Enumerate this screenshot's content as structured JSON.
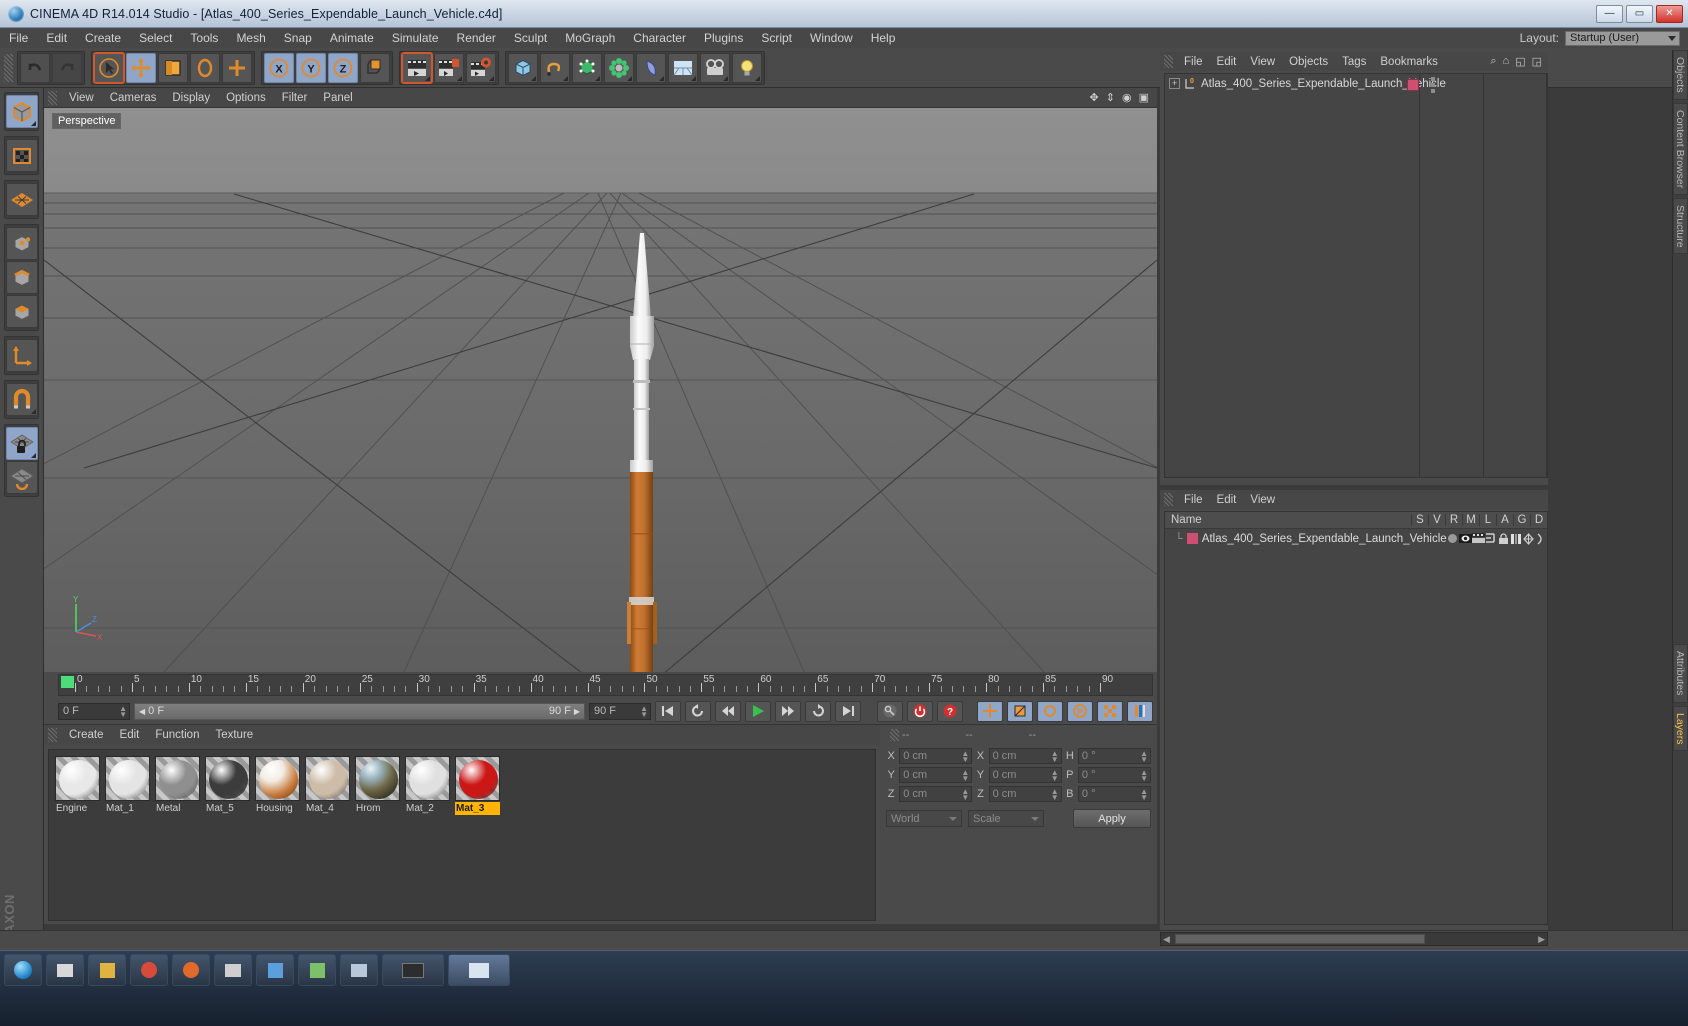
{
  "window": {
    "title": "CINEMA 4D R14.014 Studio - [Atlas_400_Series_Expendable_Launch_Vehicle.c4d]",
    "app_icon": "cinema4d-logo-icon",
    "minimize_label": "—",
    "maximize_label": "▭",
    "close_label": "✕"
  },
  "menubar": {
    "items": [
      {
        "label": "File"
      },
      {
        "label": "Edit"
      },
      {
        "label": "Create"
      },
      {
        "label": "Select"
      },
      {
        "label": "Tools"
      },
      {
        "label": "Mesh"
      },
      {
        "label": "Snap"
      },
      {
        "label": "Animate"
      },
      {
        "label": "Simulate"
      },
      {
        "label": "Render"
      },
      {
        "label": "Sculpt"
      },
      {
        "label": "MoGraph"
      },
      {
        "label": "Character"
      },
      {
        "label": "Plugins"
      },
      {
        "label": "Script"
      },
      {
        "label": "Window"
      },
      {
        "label": "Help"
      }
    ],
    "layout_label": "Layout:",
    "layout_value": "Startup (User)"
  },
  "toolbar": {
    "groups": [
      {
        "name": "undo-redo",
        "buttons": [
          {
            "name": "undo-button",
            "icon": "undo-arrow-icon",
            "state": "normal"
          },
          {
            "name": "redo-button",
            "icon": "redo-arrow-icon",
            "state": "disabled"
          }
        ]
      },
      {
        "name": "transform-tools",
        "buttons": [
          {
            "name": "live-selection-tool",
            "icon": "cursor-arrow-icon",
            "state": "highlight"
          },
          {
            "name": "move-tool",
            "icon": "move-axis-icon",
            "state": "selected"
          },
          {
            "name": "scale-tool",
            "icon": "scale-box-icon",
            "state": "normal"
          },
          {
            "name": "rotate-tool",
            "icon": "rotate-arc-icon",
            "state": "normal"
          },
          {
            "name": "soft-interaction-tool",
            "icon": "plus-cross-icon",
            "state": "normal"
          }
        ]
      },
      {
        "name": "axis-locks",
        "buttons": [
          {
            "name": "lock-x-axis-button",
            "icon": "x-axis-icon",
            "state": "selected"
          },
          {
            "name": "lock-y-axis-button",
            "icon": "y-axis-icon",
            "state": "selected"
          },
          {
            "name": "lock-z-axis-button",
            "icon": "z-axis-icon",
            "state": "selected"
          },
          {
            "name": "world-object-coordinates-button",
            "icon": "world-axis-icon",
            "state": "normal"
          }
        ]
      },
      {
        "name": "render-tools",
        "buttons": [
          {
            "name": "render-view-button",
            "icon": "clapboard-icon",
            "state": "highlight"
          },
          {
            "name": "render-to-picture-viewer-button",
            "icon": "clapboard-picture-icon",
            "state": "normal"
          },
          {
            "name": "render-settings-button",
            "icon": "clapboard-gear-icon",
            "state": "normal"
          }
        ]
      },
      {
        "name": "primitives",
        "buttons": [
          {
            "name": "add-cube-button",
            "icon": "cube-icon",
            "state": "normal"
          },
          {
            "name": "add-spline-button",
            "icon": "spline-pen-icon",
            "state": "normal"
          },
          {
            "name": "add-nurbs-button",
            "icon": "hypernurbs-icon",
            "state": "normal"
          },
          {
            "name": "add-array-button",
            "icon": "array-icon",
            "state": "normal"
          },
          {
            "name": "add-bend-deformer-button",
            "icon": "bend-deformer-icon",
            "state": "normal"
          },
          {
            "name": "add-floor-button",
            "icon": "floor-environment-icon",
            "state": "normal"
          },
          {
            "name": "add-camera-button",
            "icon": "camera-icon",
            "state": "normal"
          },
          {
            "name": "add-light-button",
            "icon": "light-bulb-icon",
            "state": "normal"
          }
        ]
      }
    ]
  },
  "left_palette": {
    "groups": [
      {
        "buttons": [
          {
            "name": "model-mode-button",
            "icon": "cube-model-icon",
            "state": "selected"
          }
        ]
      },
      {
        "buttons": [
          {
            "name": "texture-mode-button",
            "icon": "checker-texture-icon",
            "state": "normal"
          }
        ]
      },
      {
        "buttons": [
          {
            "name": "polygon-axis-mode-button",
            "icon": "grid-diamond-icon",
            "state": "normal"
          }
        ]
      },
      {
        "buttons": [
          {
            "name": "points-mode-button",
            "icon": "points-cube-icon",
            "state": "normal"
          },
          {
            "name": "edges-mode-button",
            "icon": "edges-cube-icon",
            "state": "normal"
          },
          {
            "name": "polygons-mode-button",
            "icon": "polygons-cube-icon",
            "state": "normal"
          }
        ]
      },
      {
        "buttons": [
          {
            "name": "enable-axis-modification-button",
            "icon": "axis-l-icon",
            "state": "normal"
          }
        ]
      },
      {
        "buttons": [
          {
            "name": "enable-snapping-button",
            "icon": "magnet-icon",
            "state": "normal"
          }
        ]
      },
      {
        "buttons": [
          {
            "name": "lock-workplane-button",
            "icon": "workplane-lock-icon",
            "state": "selected"
          }
        ]
      },
      {
        "buttons": [
          {
            "name": "workplane-mode-button",
            "icon": "workplane-rotate-icon",
            "state": "normal"
          }
        ]
      }
    ]
  },
  "viewport": {
    "menu": [
      {
        "label": "View"
      },
      {
        "label": "Cameras"
      },
      {
        "label": "Display"
      },
      {
        "label": "Options"
      },
      {
        "label": "Filter"
      },
      {
        "label": "Panel"
      }
    ],
    "label": "Perspective",
    "axis": {
      "x": "X",
      "y": "Y",
      "z": "Z"
    },
    "scene_object": "Atlas 400 Series Expendable Launch Vehicle rocket",
    "corner_icons": [
      "pan-icon",
      "dolly-icon",
      "zoom-icon",
      "maximize-view-icon"
    ]
  },
  "timeline": {
    "ticks": [
      0,
      5,
      10,
      15,
      20,
      25,
      30,
      35,
      40,
      45,
      50,
      55,
      60,
      65,
      70,
      75,
      80,
      85,
      90
    ],
    "current_frame_field": "0 F",
    "current_frame_left": "0 F",
    "bar_start": "0 F",
    "bar_end": "90 F",
    "end_frame_field": "90 F",
    "preview_min": "0 F",
    "preview_max": "90 F",
    "transport": [
      {
        "name": "go-to-start-button",
        "icon": "skip-back-icon"
      },
      {
        "name": "play-backwards-loop-button",
        "icon": "loop-icon"
      },
      {
        "name": "step-back-button",
        "icon": "step-back-icon"
      },
      {
        "name": "play-button",
        "icon": "play-icon"
      },
      {
        "name": "step-forward-button",
        "icon": "step-forward-icon"
      },
      {
        "name": "play-forward-loop-button",
        "icon": "loop-forward-icon"
      },
      {
        "name": "go-to-end-button",
        "icon": "skip-forward-icon"
      }
    ],
    "keyframe_tools": [
      {
        "name": "autokeying-button",
        "icon": "key-icon"
      },
      {
        "name": "record-active-objects-button",
        "icon": "record-circle-icon"
      },
      {
        "name": "keyframe-selection-button",
        "icon": "question-circle-icon"
      },
      {
        "name": "position-key-button",
        "icon": "move-key-icon"
      },
      {
        "name": "scale-key-button",
        "icon": "scale-key-icon"
      },
      {
        "name": "rotation-key-button",
        "icon": "rotate-key-icon"
      },
      {
        "name": "param-key-button",
        "icon": "param-key-icon"
      },
      {
        "name": "pla-key-button",
        "icon": "pla-key-icon"
      },
      {
        "name": "animation-layer-button",
        "icon": "layers-key-icon"
      }
    ]
  },
  "material_manager": {
    "menu": [
      {
        "label": "Create"
      },
      {
        "label": "Edit"
      },
      {
        "label": "Function"
      },
      {
        "label": "Texture"
      }
    ],
    "materials": [
      {
        "name": "Engine",
        "color": "#e8e8e8",
        "selected": false,
        "preview": "glossy-white-sphere"
      },
      {
        "name": "Mat_1",
        "color": "#e4e4e4",
        "selected": false,
        "preview": "glossy-white-sphere"
      },
      {
        "name": "Metal",
        "color": "#8f8f8f",
        "selected": false,
        "preview": "glossy-grey-sphere"
      },
      {
        "name": "Mat_5",
        "color": "#3c3c3c",
        "selected": false,
        "preview": "glossy-dark-sphere"
      },
      {
        "name": "Housing",
        "color": "#c87a3c",
        "selected": false,
        "preview": "textured-rocket-sphere"
      },
      {
        "name": "Mat_4",
        "color": "#cdbca8",
        "selected": false,
        "preview": "beige-sphere"
      },
      {
        "name": "Hrom",
        "color": "#7d7258",
        "selected": false,
        "preview": "chrome-reflective-sphere"
      },
      {
        "name": "Mat_2",
        "color": "#e0e0e0",
        "selected": false,
        "preview": "glossy-white-sphere"
      },
      {
        "name": "Mat_3",
        "color": "#cc1717",
        "selected": true,
        "preview": "glossy-red-sphere"
      }
    ]
  },
  "coordinate_manager": {
    "headers": [
      "--",
      "--",
      "--"
    ],
    "rows": [
      {
        "pos_label": "X",
        "pos_value": "0 cm",
        "size_label": "X",
        "size_value": "0 cm",
        "rot_label": "H",
        "rot_value": "0 °"
      },
      {
        "pos_label": "Y",
        "pos_value": "0 cm",
        "size_label": "Y",
        "size_value": "0 cm",
        "rot_label": "P",
        "rot_value": "0 °"
      },
      {
        "pos_label": "Z",
        "pos_value": "0 cm",
        "size_label": "Z",
        "size_value": "0 cm",
        "rot_label": "B",
        "rot_value": "0 °"
      }
    ],
    "coord_system": "World",
    "size_mode": "Scale",
    "apply_label": "Apply"
  },
  "object_manager": {
    "menu": [
      {
        "label": "File"
      },
      {
        "label": "Edit"
      },
      {
        "label": "View"
      },
      {
        "label": "Objects"
      },
      {
        "label": "Tags"
      },
      {
        "label": "Bookmarks"
      }
    ],
    "header_icons": [
      "search-icon",
      "home-icon",
      "collapse-icon",
      "expand-icon"
    ],
    "objects": [
      {
        "name": "Atlas_400_Series_Expendable_Launch_Vehicle",
        "level": 0,
        "layer_color": "#cf4f72",
        "expand_icon": "expand-plus-icon",
        "null_icon": "null-object-icon"
      }
    ]
  },
  "layer_manager": {
    "menu": [
      {
        "label": "File"
      },
      {
        "label": "Edit"
      },
      {
        "label": "View"
      }
    ],
    "columns": [
      "Name",
      "S",
      "V",
      "R",
      "M",
      "L",
      "A",
      "G",
      "D"
    ],
    "rows": [
      {
        "name": "Atlas_400_Series_Expendable_Launch_Vehicle",
        "color": "#cf4f72",
        "solo": "solo-dot-icon",
        "view": "eye-icon",
        "render": "render-icon",
        "manager": "manager-icon",
        "lock": "lock-icon",
        "animation": "animation-icon",
        "generators": "generators-icon",
        "deformers": "deformers-icon"
      }
    ]
  },
  "side_tabs": [
    {
      "label": "Objects",
      "active": false
    },
    {
      "label": "Content Browser",
      "active": false
    },
    {
      "label": "Structure",
      "active": false
    },
    {
      "label": "Attributes",
      "active": false
    },
    {
      "label": "Layers",
      "active": true
    }
  ],
  "branding": {
    "maxon": "MAXON",
    "product": "CINEMA 4D"
  },
  "colors": {
    "accent_orange": "#e08a2b",
    "selection_blue": "#8fa6c8",
    "highlight_red": "#d2572b",
    "selected_yellow": "#ffb400",
    "panel_bg": "#4a4a4a",
    "field_bg": "#3a3a3a",
    "layer_pink": "#cf4f72",
    "playhead_green": "#4ddc7a"
  }
}
